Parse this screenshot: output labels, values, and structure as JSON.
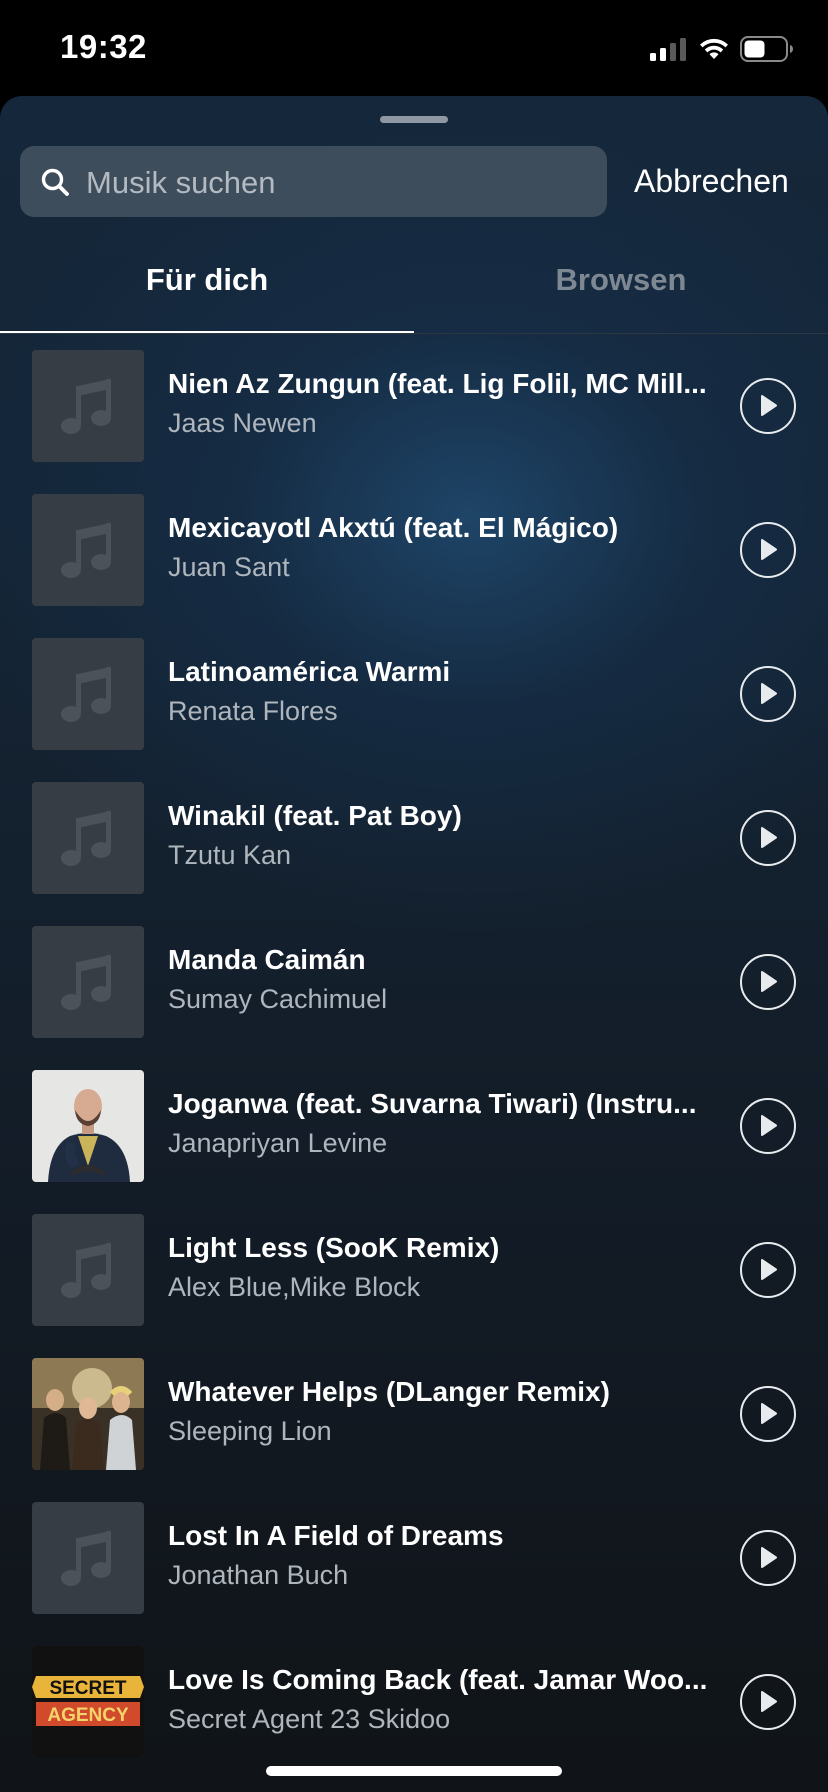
{
  "status_bar": {
    "time": "19:32"
  },
  "search": {
    "placeholder": "Musik suchen",
    "value": "",
    "cancel_label": "Abbrechen"
  },
  "tabs": [
    {
      "label": "Für dich",
      "active": true
    },
    {
      "label": "Browsen",
      "active": false
    }
  ],
  "songs": [
    {
      "title": "Nien Az Zungun (feat. Lig Folil, MC Mill...",
      "artist": "Jaas Newen",
      "artwork": "music-note-placeholder"
    },
    {
      "title": "Mexicayotl Akxtú (feat. El Mágico)",
      "artist": "Juan Sant",
      "artwork": "music-note-placeholder"
    },
    {
      "title": "Latinoamérica Warmi",
      "artist": "Renata Flores",
      "artwork": "music-note-placeholder"
    },
    {
      "title": "Winakil (feat. Pat Boy)",
      "artist": "Tzutu Kan",
      "artwork": "music-note-placeholder"
    },
    {
      "title": "Manda Caimán",
      "artist": "Sumay Cachimuel",
      "artwork": "music-note-placeholder"
    },
    {
      "title": "Joganwa (feat. Suvarna Tiwari) (Instru...",
      "artist": "Janapriyan Levine",
      "artwork": "portrait-photo"
    },
    {
      "title": "Light Less (SooK Remix)",
      "artist": "Alex Blue,Mike Block",
      "artwork": "music-note-placeholder"
    },
    {
      "title": "Whatever Helps (DLanger Remix)",
      "artist": "Sleeping Lion",
      "artwork": "band-photo"
    },
    {
      "title": "Lost In A Field of Dreams",
      "artist": "Jonathan Buch",
      "artwork": "music-note-placeholder"
    },
    {
      "title": "Love Is Coming Back (feat. Jamar Woo...",
      "artist": "Secret Agent 23 Skidoo",
      "artwork": "secret-agent-logo"
    }
  ],
  "artwork_logo_text": "SECRET AGENCY",
  "colors": {
    "background_top": "#15273a",
    "background_bottom": "#101418",
    "search_field": "#3e4d5c",
    "artist_text": "#aeb5bc",
    "inactive_tab": "#7e8893",
    "placeholder_artwork": "#363d45"
  }
}
